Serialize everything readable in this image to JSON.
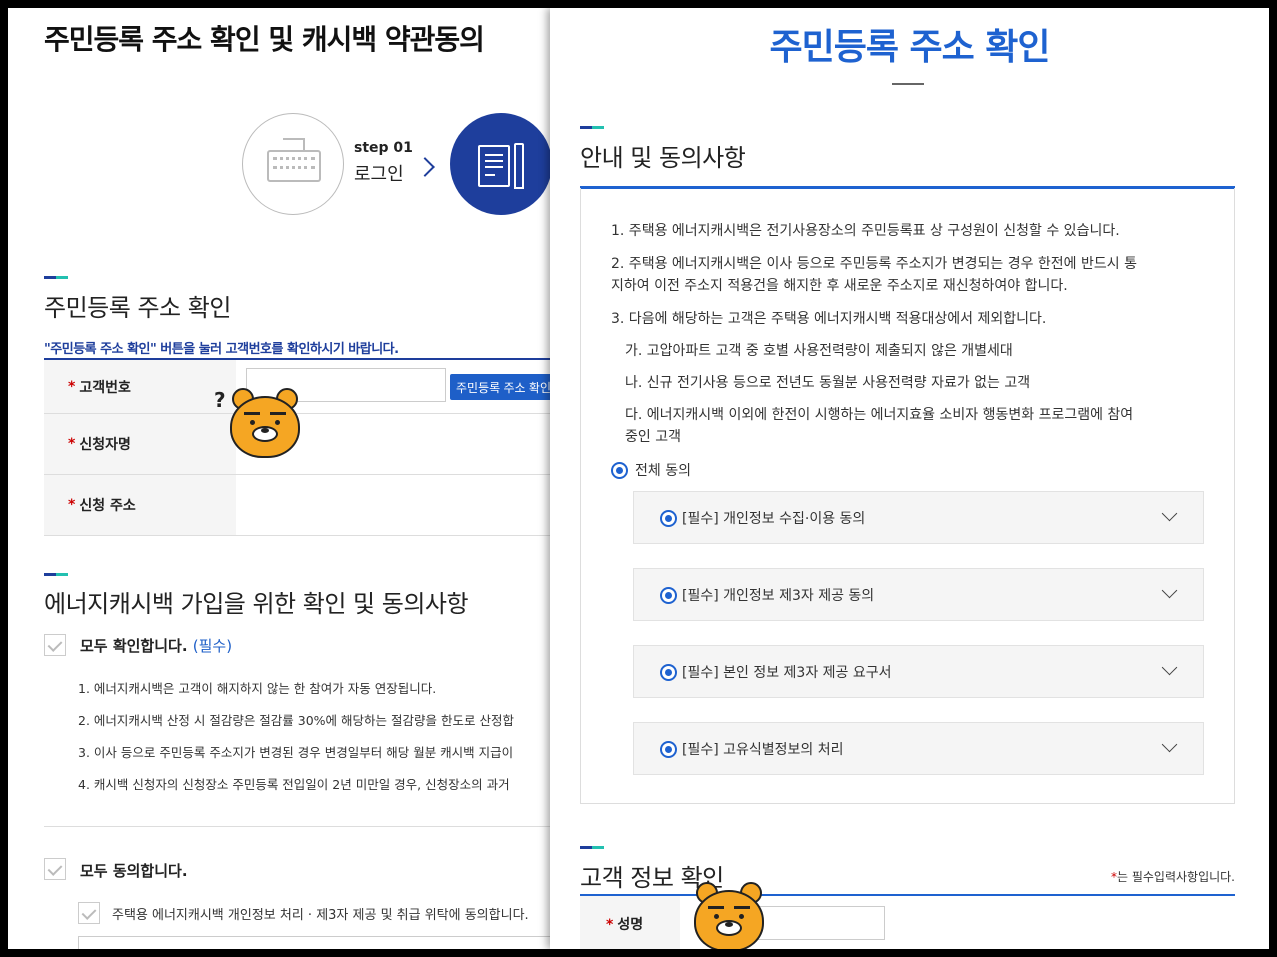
{
  "background_page": {
    "title": "주민등록 주소 확인 및 캐시백 약관동의",
    "steps": [
      {
        "step": "step 01",
        "label": "로그인"
      }
    ],
    "address_section": {
      "title": "주민등록 주소 확인",
      "notice": "\"주민등록 주소 확인\" 버튼을 눌러 고객번호를 확인하시기 바랍니다.",
      "rows": [
        {
          "label": "고객번호",
          "required": "*"
        },
        {
          "label": "신청자명",
          "required": "*"
        },
        {
          "label": "신청 주소",
          "required": "*"
        }
      ],
      "verify_button": "주민등록 주소 확인"
    },
    "energy_section": {
      "title": "에너지캐시백 가입을 위한 확인 및 동의사항",
      "confirm_all": "모두 확인합니다.",
      "confirm_required": "(필수)",
      "items": [
        "1. 에너지캐시백은 고객이 해지하지 않는 한 참여가 자동 연장됩니다.",
        "2. 에너지캐시백 산정 시 절감량은 절감률 30%에 해당하는 절감량을 한도로 산정합",
        "3. 이사 등으로 주민등록 주소지가 변경된 경우 변경일부터 해당 월분 캐시백 지급이",
        "4. 캐시백 신청자의 신청장소 주민등록 전입일이 2년 미만일 경우, 신청장소의 과거"
      ],
      "agree_all": "모두 동의합니다.",
      "sub_agree": "주택용 에너지캐시백 개인정보 처리 · 제3자 제공 및 취급 위탁에 동의합니다."
    }
  },
  "popup": {
    "title": "주민등록 주소 확인",
    "guide_section": {
      "title": "안내 및 동의사항",
      "paragraphs": [
        "1. 주택용 에너지캐시백은 전기사용장소의 주민등록표 상 구성원이 신청할 수 있습니다.",
        "2. 주택용 에너지캐시백은 이사 등으로 주민등록 주소지가 변경되는 경우 한전에 반드시 통",
        "지하여 이전 주소지 적용건을 해지한 후 새로운 주소지로 재신청하여야 합니다.",
        "3. 다음에 해당하는 고객은 주택용 에너지캐시백 적용대상에서 제외합니다.",
        "가. 고압아파트 고객 중 호별 사용전력량이 제출되지 않은 개별세대",
        "나. 신규 전기사용 등으로 전년도 동월분 사용전력량 자료가 없는 고객",
        "다. 에너지캐시백 이외에 한전이 시행하는 에너지효율 소비자 행동변화 프로그램에 참여",
        "중인 고객"
      ],
      "all_agree": "전체 동의",
      "accordions": [
        "[필수] 개인정보 수집·이용 동의",
        "[필수] 개인정보 제3자 제공 동의",
        "[필수] 본인 정보 제3자 제공 요구서",
        "[필수] 고유식별정보의 처리"
      ]
    },
    "customer_section": {
      "title": "고객 정보 확인",
      "required_mark": "*",
      "required_note": "는 필수입력사항입니다.",
      "name_label": "성명"
    }
  },
  "colors": {
    "brand_blue": "#1e62d0",
    "navy": "#1e3e9c",
    "accent_teal": "#22c0b0",
    "required_red": "#cc0000"
  }
}
